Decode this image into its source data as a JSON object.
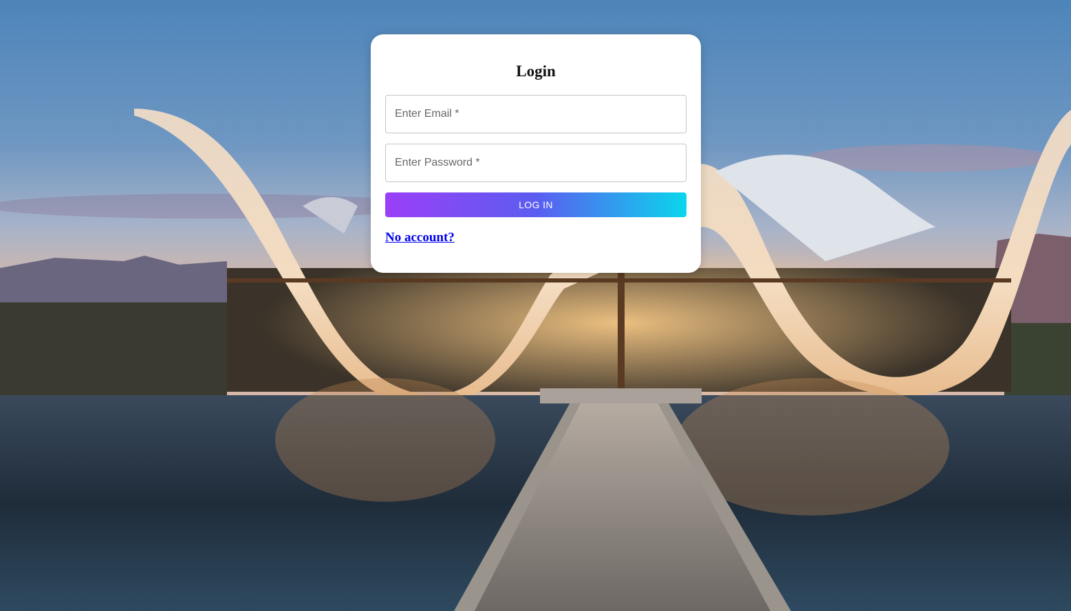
{
  "login": {
    "title": "Login",
    "email_placeholder": "Enter Email *",
    "password_placeholder": "Enter Password *",
    "submit_label": "LOG IN",
    "signup_link": "No account?"
  },
  "colors": {
    "button_gradient_start": "#9b3ff7",
    "button_gradient_mid": "#5b5df0",
    "button_gradient_end": "#0ad6ec",
    "link": "#0000ee",
    "card_background": "#ffffff"
  },
  "background": {
    "icon": "chapel-landscape-photo"
  }
}
